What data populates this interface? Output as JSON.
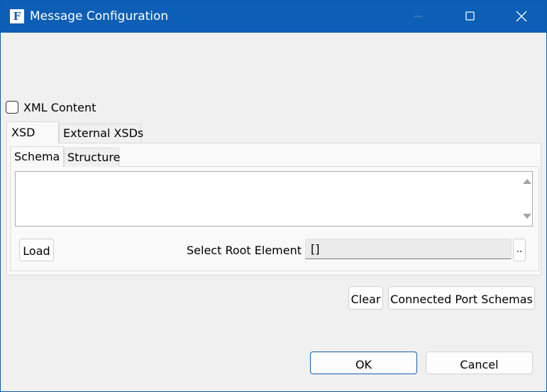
{
  "window": {
    "title": "Message Configuration",
    "app_icon": "F",
    "controls": {
      "minimize": "minimize-icon",
      "maximize": "maximize-icon",
      "close": "close-icon"
    }
  },
  "xml_content": {
    "label": "XML Content",
    "checked": false
  },
  "outer_tabs": [
    {
      "label": "XSD",
      "active": true
    },
    {
      "label": "External XSDs",
      "active": false
    }
  ],
  "inner_tabs": [
    {
      "label": "Schema",
      "active": true
    },
    {
      "label": "Structure",
      "active": false
    }
  ],
  "schema_text": "",
  "load_button": "Load",
  "root_element": {
    "label": "Select Root Element",
    "value": "[]",
    "browse_label": ".."
  },
  "actions": {
    "clear": "Clear",
    "connected_port_schemas": "Connected Port Schemas"
  },
  "dialog_buttons": {
    "ok": "OK",
    "cancel": "Cancel"
  },
  "colors": {
    "titlebar": "#0c5fb4",
    "background": "#f0f0f0",
    "panel": "#f9f9f9"
  }
}
